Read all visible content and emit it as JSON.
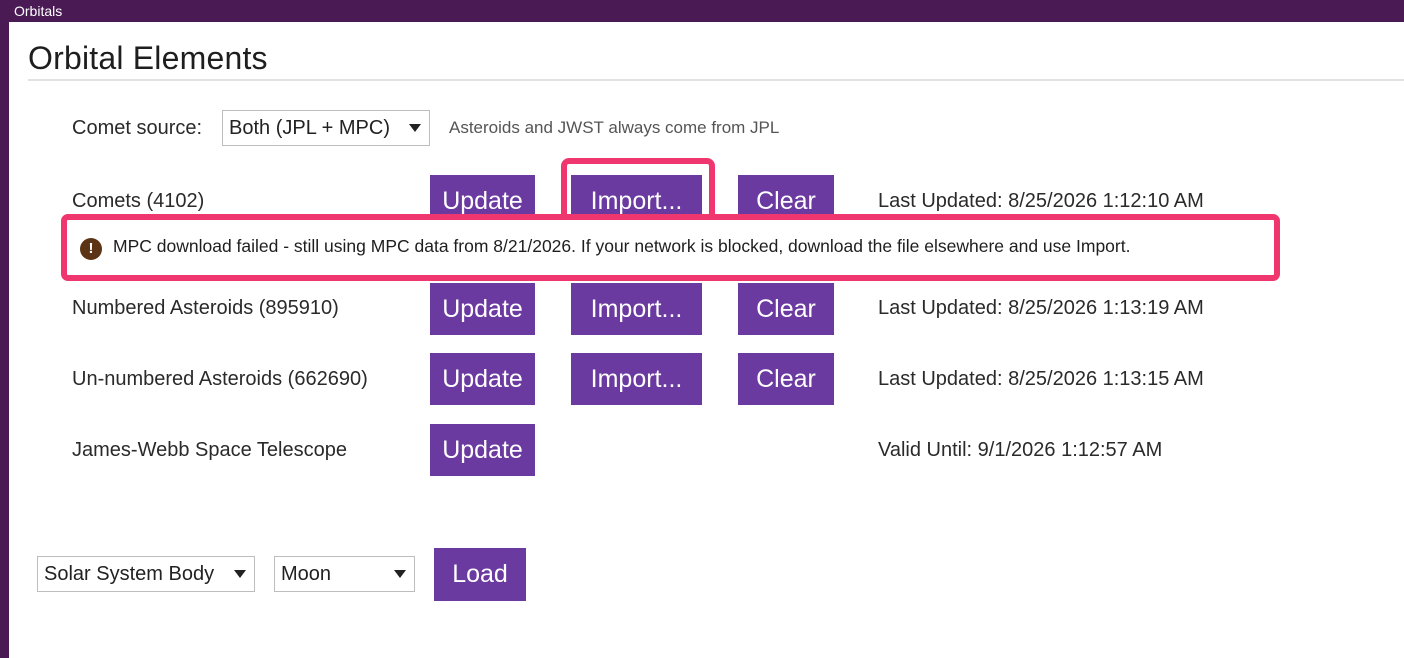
{
  "window": {
    "title": "Orbitals"
  },
  "page": {
    "title": "Orbital Elements"
  },
  "comet_source": {
    "label": "Comet source:",
    "selected": "Both (JPL + MPC)",
    "hint": "Asteroids and JWST always come from JPL"
  },
  "rows": [
    {
      "label": "Comets (4102)",
      "update_label": "Update",
      "import_label": "Import...",
      "clear_label": "Clear",
      "status": "Last Updated: 8/25/2026 1:12:10 AM"
    },
    {
      "label": "Numbered Asteroids (895910)",
      "update_label": "Update",
      "import_label": "Import...",
      "clear_label": "Clear",
      "status": "Last Updated: 8/25/2026 1:13:19 AM"
    },
    {
      "label": "Un-numbered Asteroids (662690)",
      "update_label": "Update",
      "import_label": "Import...",
      "clear_label": "Clear",
      "status": "Last Updated: 8/25/2026 1:13:15 AM"
    },
    {
      "label": "James-Webb Space Telescope",
      "update_label": "Update",
      "status": "Valid Until: 9/1/2026 1:12:57 AM"
    }
  ],
  "warning": {
    "icon": "!",
    "text": "MPC download failed - still using MPC data from 8/21/2026. If your network is blocked, download the file elsewhere and use Import."
  },
  "loader": {
    "body_type": "Solar System Body",
    "body": "Moon",
    "load_label": "Load"
  },
  "colors": {
    "accent": "#6b3aa0",
    "titlebar": "#4a1a55",
    "highlight": "#f0366e",
    "warning_icon": "#5a3414"
  },
  "icons": {
    "warning": "warning-circle-icon",
    "dropdown": "chevron-down-icon"
  }
}
